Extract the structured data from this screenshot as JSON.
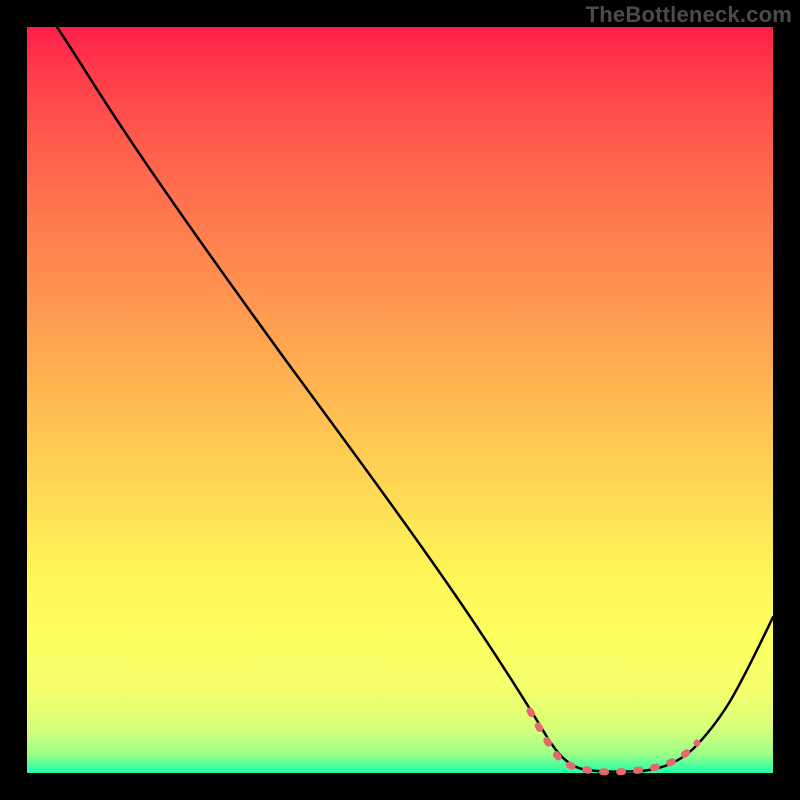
{
  "watermark": "TheBottleneck.com",
  "colors": {
    "frame": "#000000",
    "gradient_top": "#ff1f4a",
    "gradient_bottom": "#1fffaf",
    "curve": "#000000",
    "marker": "#e36a6a"
  },
  "chart_data": {
    "type": "line",
    "title": "",
    "xlabel": "",
    "ylabel": "",
    "xlim": [
      0,
      100
    ],
    "ylim": [
      0,
      100
    ],
    "x": [
      0,
      4,
      10,
      15,
      20,
      25,
      30,
      35,
      40,
      45,
      50,
      55,
      60,
      63,
      66,
      68,
      70,
      72,
      74,
      76,
      78,
      80,
      82,
      84,
      86,
      88,
      90,
      92,
      94,
      96,
      98,
      100
    ],
    "values": [
      100,
      98,
      93,
      87,
      80,
      73,
      66,
      59,
      52,
      45,
      37,
      29,
      21,
      15,
      10,
      7,
      5,
      3,
      2,
      1,
      0.5,
      0.5,
      0.5,
      1,
      2,
      4,
      6,
      9,
      13,
      17,
      21,
      26
    ],
    "markers_x": [
      63,
      66,
      68,
      70,
      72,
      74,
      76,
      78,
      80,
      82,
      84,
      86,
      88
    ],
    "annotations": []
  }
}
